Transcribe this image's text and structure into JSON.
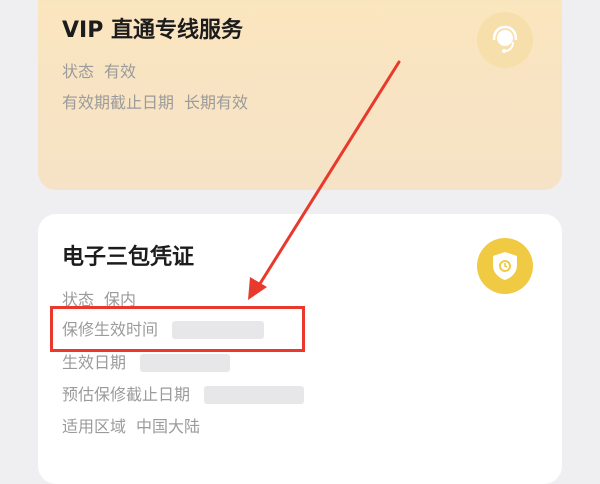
{
  "vip_card": {
    "title": "VIP 直通专线服务",
    "status_label": "状态",
    "status_value": "有效",
    "expiry_label": "有效期截止日期",
    "expiry_value": "长期有效",
    "icon": "customer-service-headset-icon",
    "badge_color": "#f7dfab"
  },
  "warranty_card": {
    "title": "电子三包凭证",
    "status_label": "状态",
    "status_value": "保内",
    "effective_time_label": "保修生效时间",
    "effective_date_label": "生效日期",
    "estimated_expiry_label": "预估保修截止日期",
    "region_label": "适用区域",
    "region_value": "中国大陆",
    "icon": "shield-icon",
    "badge_color": "#f1ca43"
  },
  "annotation": {
    "color": "#e8392c"
  }
}
